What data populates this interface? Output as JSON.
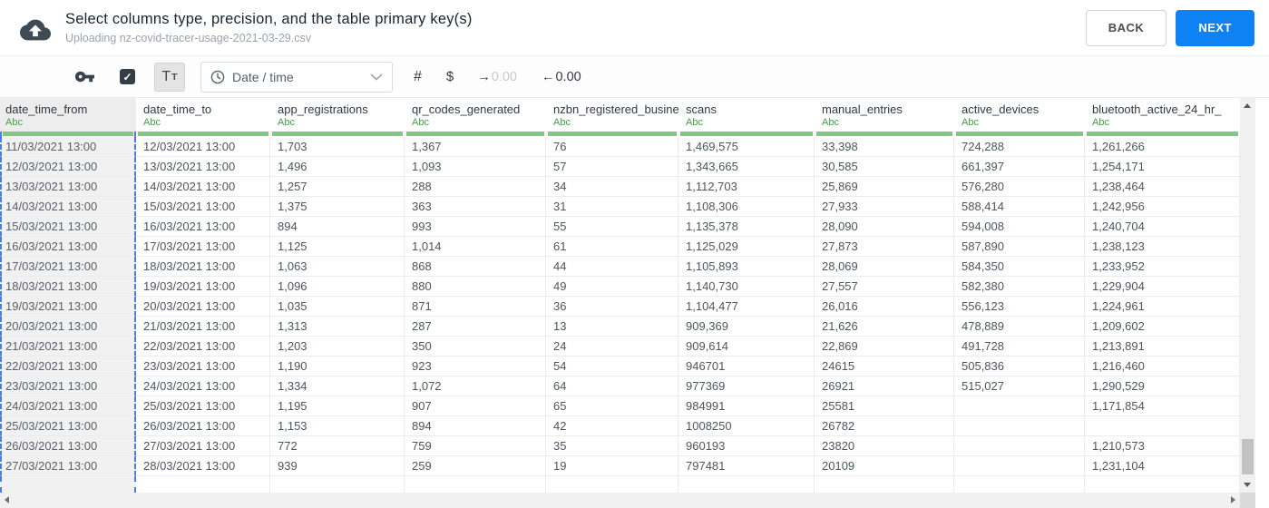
{
  "header": {
    "title": "Select columns type, precision, and the table primary key(s)",
    "subtitle": "Uploading nz-covid-tracer-usage-2021-03-29.csv",
    "back_label": "BACK",
    "next_label": "NEXT"
  },
  "toolbar": {
    "key_icon": "primary-key",
    "checkbox_checked": true,
    "check_icon": "✓",
    "text_type_primary": "T",
    "text_type_secondary": "T",
    "clock_icon": "date-time",
    "type_dropdown_value": "Date / time",
    "number_sign": "#",
    "dollar_sign": "$",
    "decimal_shift_right": {
      "arrow": "→",
      "digits": "0.00"
    },
    "decimal_shift_left": {
      "arrow": "←",
      "digits": "0.00"
    }
  },
  "table": {
    "type_badge": "Abc",
    "columns": [
      {
        "name": "date_time_from",
        "type": "Abc",
        "selected": true
      },
      {
        "name": "date_time_to",
        "type": "Abc",
        "selected": false
      },
      {
        "name": "app_registrations",
        "type": "Abc",
        "selected": false
      },
      {
        "name": "qr_codes_generated",
        "type": "Abc",
        "selected": false
      },
      {
        "name": "nzbn_registered_busine",
        "type": "Abc",
        "selected": false
      },
      {
        "name": "scans",
        "type": "Abc",
        "selected": false
      },
      {
        "name": "manual_entries",
        "type": "Abc",
        "selected": false
      },
      {
        "name": "active_devices",
        "type": "Abc",
        "selected": false
      },
      {
        "name": "bluetooth_active_24_hr_",
        "type": "Abc",
        "selected": false
      }
    ],
    "rows": [
      [
        "11/03/2021 13:00",
        "12/03/2021 13:00",
        "1,703",
        "1,367",
        "76",
        "1,469,575",
        "33,398",
        "724,288",
        "1,261,266"
      ],
      [
        "12/03/2021 13:00",
        "13/03/2021 13:00",
        "1,496",
        "1,093",
        "57",
        "1,343,665",
        "30,585",
        "661,397",
        "1,254,171"
      ],
      [
        "13/03/2021 13:00",
        "14/03/2021 13:00",
        "1,257",
        "288",
        "34",
        "1,112,703",
        "25,869",
        "576,280",
        "1,238,464"
      ],
      [
        "14/03/2021 13:00",
        "15/03/2021 13:00",
        "1,375",
        "363",
        "31",
        "1,108,306",
        "27,933",
        "588,414",
        "1,242,956"
      ],
      [
        "15/03/2021 13:00",
        "16/03/2021 13:00",
        "894",
        "993",
        "55",
        "1,135,378",
        "28,090",
        "594,008",
        "1,240,704"
      ],
      [
        "16/03/2021 13:00",
        "17/03/2021 13:00",
        "1,125",
        "1,014",
        "61",
        "1,125,029",
        "27,873",
        "587,890",
        "1,238,123"
      ],
      [
        "17/03/2021 13:00",
        "18/03/2021 13:00",
        "1,063",
        "868",
        "44",
        "1,105,893",
        "28,069",
        "584,350",
        "1,233,952"
      ],
      [
        "18/03/2021 13:00",
        "19/03/2021 13:00",
        "1,096",
        "880",
        "49",
        "1,140,730",
        "27,557",
        "582,380",
        "1,229,904"
      ],
      [
        "19/03/2021 13:00",
        "20/03/2021 13:00",
        "1,035",
        "871",
        "36",
        "1,104,477",
        "26,016",
        "556,123",
        "1,224,961"
      ],
      [
        "20/03/2021 13:00",
        "21/03/2021 13:00",
        "1,313",
        "287",
        "13",
        "909,369",
        "21,626",
        "478,889",
        "1,209,602"
      ],
      [
        "21/03/2021 13:00",
        "22/03/2021 13:00",
        "1,203",
        "350",
        "24",
        "909,614",
        "22,869",
        "491,728",
        "1,213,891"
      ],
      [
        "22/03/2021 13:00",
        "23/03/2021 13:00",
        "1,190",
        "923",
        "54",
        "946701",
        "24615",
        "505,836",
        "1,216,460"
      ],
      [
        "23/03/2021 13:00",
        "24/03/2021 13:00",
        "1,334",
        "1,072",
        "64",
        "977369",
        "26921",
        "515,027",
        "1,290,529"
      ],
      [
        "24/03/2021 13:00",
        "25/03/2021 13:00",
        "1,195",
        "907",
        "65",
        "984991",
        "25581",
        "",
        "1,171,854"
      ],
      [
        "25/03/2021 13:00",
        "26/03/2021 13:00",
        "1,153",
        "894",
        "42",
        "1008250",
        "26782",
        "",
        ""
      ],
      [
        "26/03/2021 13:00",
        "27/03/2021 13:00",
        "772",
        "759",
        "35",
        "960193",
        "23820",
        "",
        "1,210,573"
      ],
      [
        "27/03/2021 13:00",
        "28/03/2021 13:00",
        "939",
        "259",
        "19",
        "797481",
        "20109",
        "",
        "1,231,104"
      ]
    ]
  },
  "colors": {
    "accent_blue": "#0e82f4",
    "type_green": "#43a047",
    "header_bar_green": "#7ec889",
    "selection_dash_blue": "#4a7fe0",
    "dark_icon": "#3a454e"
  }
}
